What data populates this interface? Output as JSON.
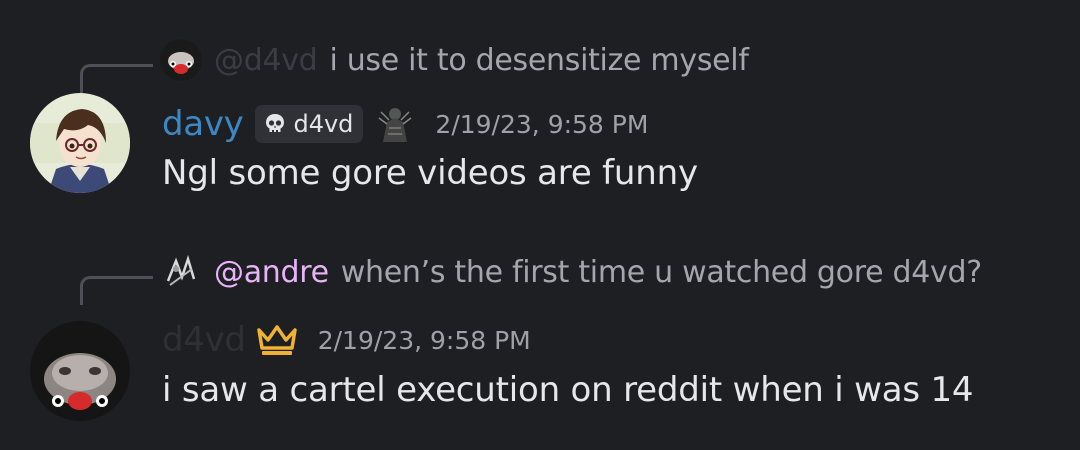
{
  "messages": [
    {
      "reply": {
        "mention": "@d4vd",
        "text": "i use it to desensitize myself",
        "mention_color": "#3b3d44",
        "avatar_icon": "pig-nose-avatar-icon"
      },
      "author": {
        "username": "davy",
        "username_color": "#3c87c4",
        "avatar_icon": "anime-boy-avatar-icon",
        "server_tag": "d4vd",
        "server_tag_icon": "skull-icon",
        "decoration_icon": "dark-figure-icon"
      },
      "timestamp": "2/19/23, 9:58 PM",
      "content": "Ngl some gore videos are funny"
    },
    {
      "reply": {
        "mention": "@andre",
        "text": "when’s the first time u watched gore d4vd?",
        "mention_color": "#e7b4f8",
        "avatar_icon": "sketch-avatar-icon"
      },
      "author": {
        "username": "d4vd",
        "username_color": "#2f3033",
        "avatar_icon": "pig-nose-avatar-icon",
        "badge_icon": "crown-icon",
        "badge_color": "#f0b232"
      },
      "timestamp": "2/19/23, 9:58 PM",
      "content": "i saw a cartel execution on reddit when i was 14"
    }
  ]
}
